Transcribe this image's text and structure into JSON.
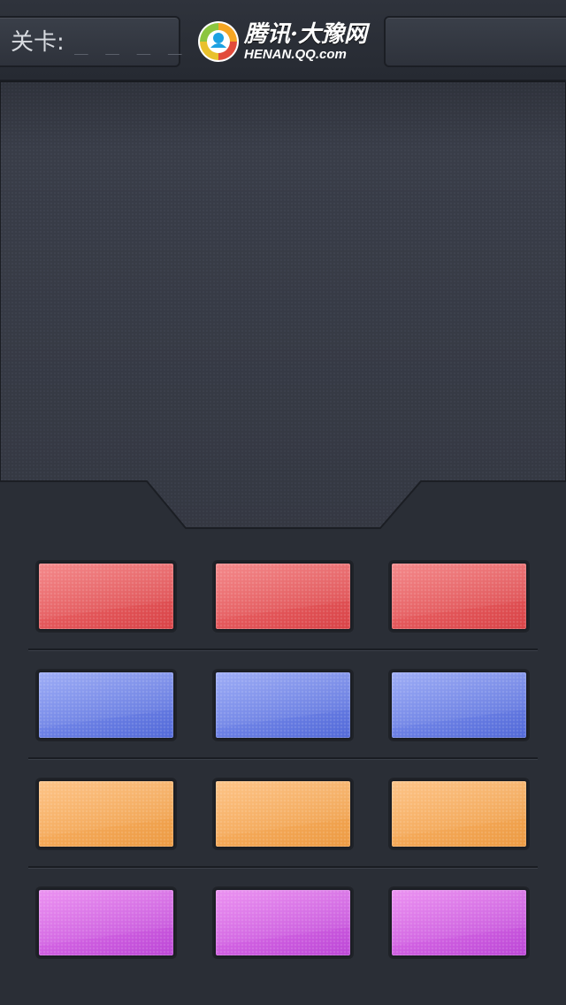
{
  "header": {
    "level_label": "关卡:",
    "level_value": "_ _ _ _",
    "logo": {
      "main_text": "腾讯·大豫网",
      "sub_text": "HENAN.QQ.com",
      "icon": "tencent-bird-logo-icon"
    }
  },
  "tile_rows": [
    {
      "color_name": "red",
      "colors": [
        "#f27173",
        "#d84246"
      ],
      "count": 3
    },
    {
      "color_name": "blue",
      "colors": [
        "#8a9cf4",
        "#5269d8"
      ],
      "count": 3
    },
    {
      "color_name": "orange",
      "colors": [
        "#fdb86f",
        "#ec9a42"
      ],
      "count": 3
    },
    {
      "color_name": "purple",
      "colors": [
        "#e77cee",
        "#bc47d6"
      ],
      "count": 3
    }
  ],
  "palette": {
    "background": "#2a2e36",
    "board": "#393d48",
    "header_box": "#353a44"
  }
}
